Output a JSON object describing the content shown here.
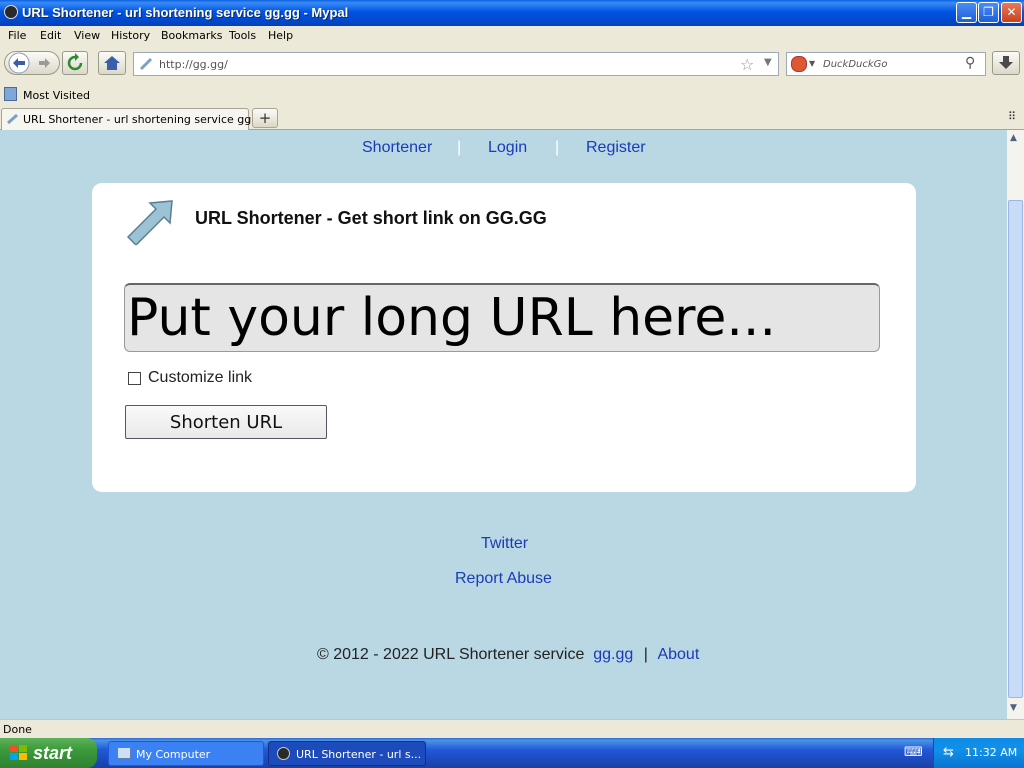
{
  "window": {
    "title": "URL Shortener - url shortening service gg.gg - Mypal",
    "controls": [
      "minimize",
      "maximize",
      "close"
    ]
  },
  "menu": [
    "File",
    "Edit",
    "View",
    "History",
    "Bookmarks",
    "Tools",
    "Help"
  ],
  "navbar": {
    "url": "http://gg.gg/",
    "search_placeholder": "DuckDuckGo"
  },
  "bookmarks": {
    "most_visited": "Most Visited"
  },
  "tabs": [
    {
      "label": "URL Shortener - url shortening service gg.gg"
    }
  ],
  "page": {
    "top_nav": [
      "Shortener",
      "Login",
      "Register"
    ],
    "title": "URL Shortener - Get short link on GG.GG",
    "url_input_placeholder": "Put your long URL here...",
    "customize_label": "Customize link",
    "shorten_button": "Shorten URL",
    "footer_links": {
      "twitter": "Twitter",
      "report_abuse": "Report Abuse"
    },
    "copyright": "© 2012 - 2022 URL Shortener service",
    "copyright_link": "gg.gg",
    "copyright_sep": "|",
    "about_link": "About"
  },
  "status": "Done",
  "taskbar": {
    "start": "start",
    "items": [
      "My Computer",
      "URL Shortener - url s..."
    ],
    "clock": "11:32 AM"
  },
  "colors": {
    "page_bg": "#b9d8e3",
    "link": "#1a3bb8",
    "xp_blue": "#0054e3"
  }
}
